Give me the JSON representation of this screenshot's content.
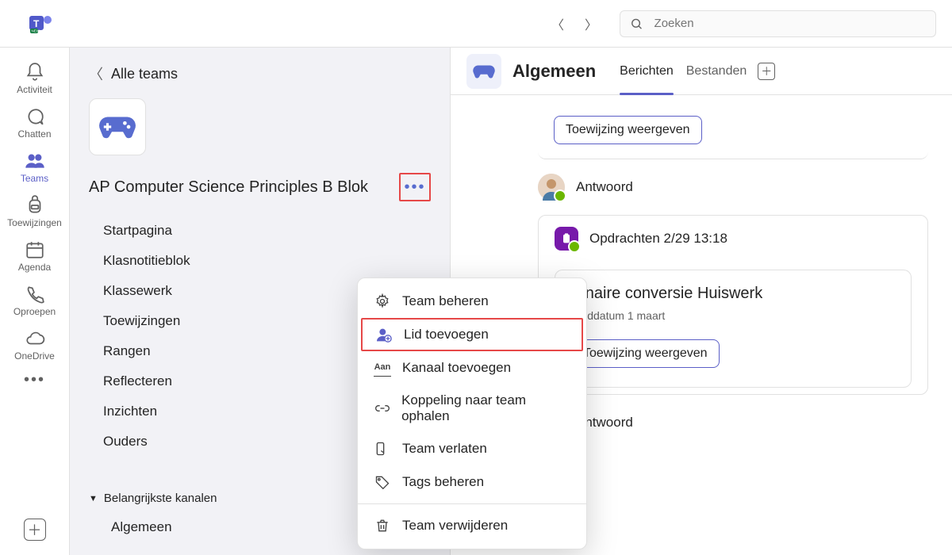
{
  "search": {
    "placeholder": "Zoeken"
  },
  "rail": {
    "activity": "Activiteit",
    "chat": "Chatten",
    "teams": "Teams",
    "assignments": "Toewijzingen",
    "calendar": "Agenda",
    "calls": "Oproepen",
    "onedrive": "OneDrive"
  },
  "left": {
    "all_teams": "Alle teams",
    "team_name": "AP Computer Science Principles B Blok",
    "nav": {
      "home": "Startpagina",
      "notebook": "Klasnotitieblok",
      "classwork": "Klassewerk",
      "assignments": "Toewijzingen",
      "grades": "Rangen",
      "reflect": "Reflecteren",
      "insights": "Inzichten",
      "parents": "Ouders"
    },
    "channels_head": "Belangrijkste kanalen",
    "channel_general": "Algemeen"
  },
  "menu": {
    "manage": "Team beheren",
    "add_member": "Lid toevoegen",
    "add_channel": "Kanaal toevoegen",
    "get_link": "Koppeling naar team ophalen",
    "leave": "Team verlaten",
    "tags": "Tags beheren",
    "delete": "Team verwijderen"
  },
  "header": {
    "channel": "Algemeen",
    "tab_posts": "Berichten",
    "tab_files": "Bestanden"
  },
  "feed": {
    "view_assignment": "Toewijzing weergeven",
    "reply": "Antwoord",
    "assign_author": "Opdrachten 2/29 13:18",
    "assign_title": "Binaire conversie Huiswerk",
    "assign_due": "Einddatum 1 maart"
  }
}
